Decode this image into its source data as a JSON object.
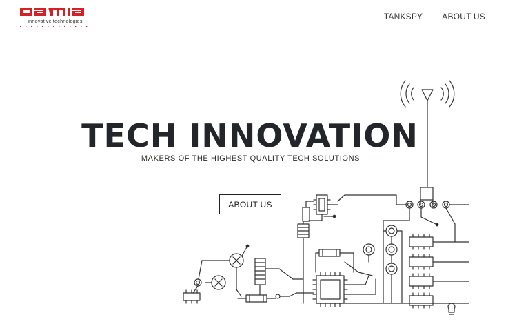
{
  "brand": {
    "logo_text": "DAMIA",
    "tagline": "innovative technologies",
    "accent_color": "#d42027"
  },
  "nav": {
    "items": [
      {
        "label": "TANKSPY"
      },
      {
        "label": "ABOUT US"
      }
    ]
  },
  "hero": {
    "title": "TECH INNOVATION",
    "subtitle": "MAKERS OF THE HIGHEST QUALITY TECH SOLUTIONS",
    "cta_label": "ABOUT US"
  },
  "illustration": {
    "icons": [
      "antenna-icon",
      "circuit-board-illustration",
      "lightbulb-icon"
    ]
  }
}
